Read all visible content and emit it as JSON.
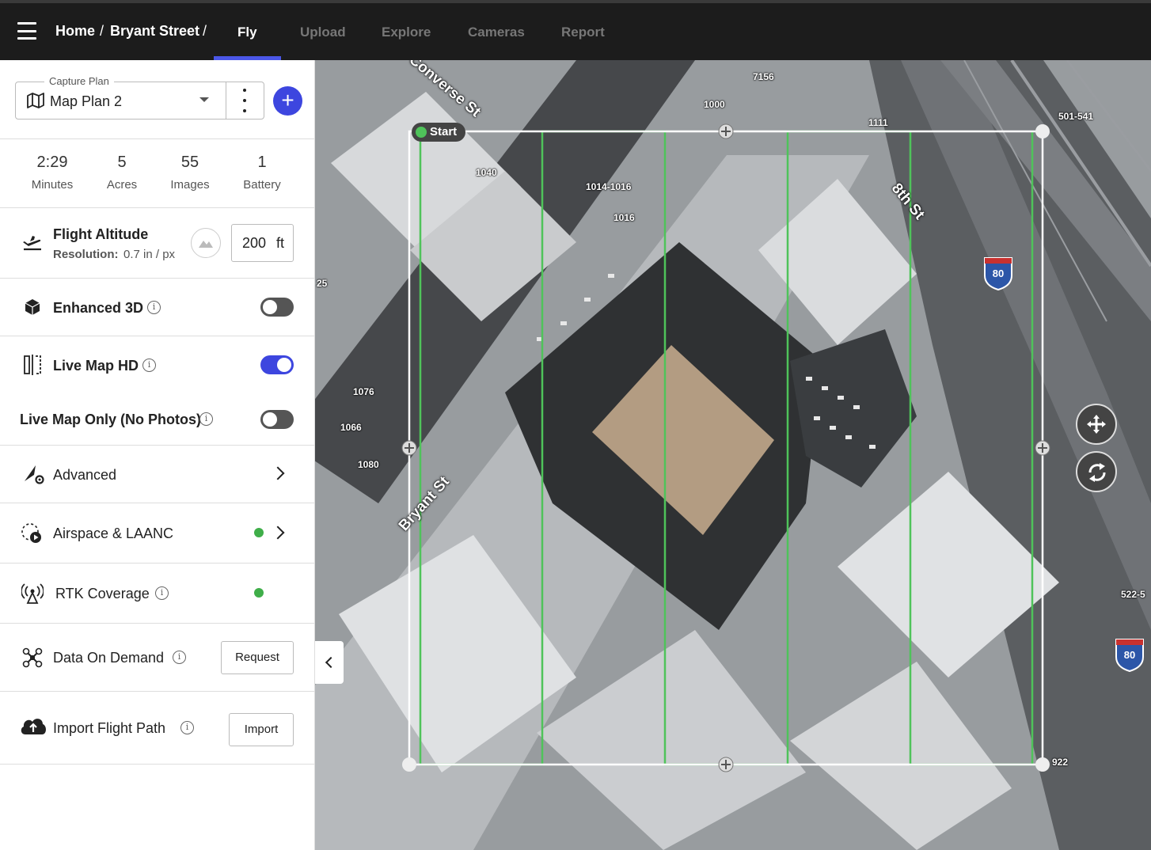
{
  "header": {
    "breadcrumb": [
      "Home",
      "Bryant Street"
    ],
    "tabs": [
      {
        "label": "Fly",
        "active": true
      },
      {
        "label": "Upload",
        "active": false
      },
      {
        "label": "Explore",
        "active": false
      },
      {
        "label": "Cameras",
        "active": false
      },
      {
        "label": "Report",
        "active": false
      }
    ],
    "accent_color": "#4b57e8"
  },
  "capture_plan": {
    "legend": "Capture Plan",
    "selected": "Map Plan 2"
  },
  "stats": [
    {
      "value": "2:29",
      "label": "Minutes"
    },
    {
      "value": "5",
      "label": "Acres"
    },
    {
      "value": "55",
      "label": "Images"
    },
    {
      "value": "1",
      "label": "Battery"
    }
  ],
  "flight_altitude": {
    "title": "Flight Altitude",
    "resolution_label": "Resolution:",
    "resolution_value": "0.7 in / px",
    "altitude_value": "200",
    "altitude_unit": "ft"
  },
  "settings": {
    "enhanced_3d": {
      "label": "Enhanced 3D",
      "enabled": false
    },
    "live_map_hd": {
      "label": "Live Map HD",
      "enabled": true
    },
    "live_map_only": {
      "label": "Live Map Only (No Photos)",
      "enabled": false
    },
    "advanced": {
      "label": "Advanced"
    },
    "airspace": {
      "label": "Airspace & LAANC",
      "status": "green"
    },
    "rtk": {
      "label": "RTK Coverage",
      "status": "green"
    },
    "data_on_demand": {
      "label": "Data On Demand",
      "button": "Request"
    },
    "import_flight_path": {
      "label": "Import Flight Path",
      "button": "Import"
    }
  },
  "map": {
    "start_label": "Start",
    "street_labels": [
      "Converse St",
      "8th St",
      "Bryant St"
    ],
    "address_labels": [
      "7156",
      "1000",
      "1111",
      "501-541",
      "1040",
      "1014-1016",
      "1016",
      "1076",
      "1066",
      "1080",
      "25",
      "522-5",
      "922"
    ],
    "highway_shield": "80"
  }
}
